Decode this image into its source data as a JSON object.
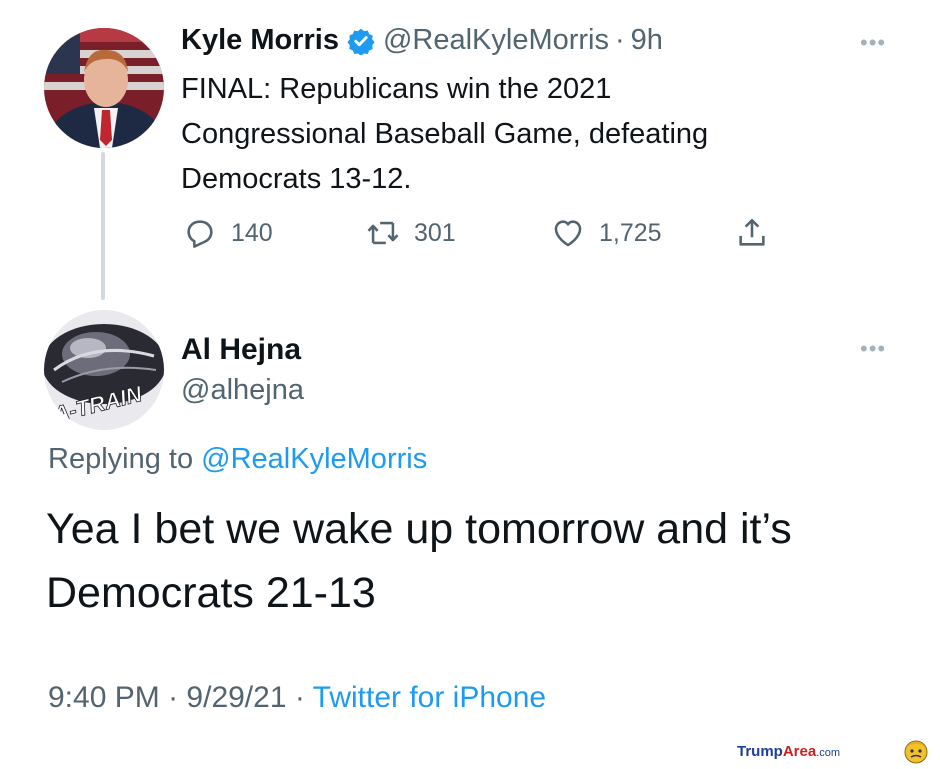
{
  "tweet": {
    "author_name": "Kyle Morris",
    "author_handle": "@RealKyleMorris",
    "separator": "·",
    "time_ago": "9h",
    "text_lines": [
      "FINAL: Republicans win the 2021",
      "Congressional Baseball Game, defeating",
      "Democrats 13-12."
    ],
    "more_label": "•••",
    "actions": {
      "reply_count": "140",
      "retweet_count": "301",
      "like_count": "1,725"
    }
  },
  "reply": {
    "author_name": "Al Hejna",
    "author_handle": "@alhejna",
    "avatar_text": "A-TRAIN",
    "more_label": "•••",
    "replying_prefix": "Replying to",
    "replying_mention": "@RealKyleMorris",
    "text_lines": [
      "Yea I bet we wake up tomorrow and it’s",
      "Democrats 21-13"
    ],
    "time": "9:40 PM",
    "separator": "·",
    "date": "9/29/21",
    "source": "Twitter for iPhone"
  },
  "watermark": {
    "part1": "Trump",
    "part2": "Area",
    "part3": ".com"
  },
  "colors": {
    "accent": "#1d9bf0",
    "secondary_text": "#536471",
    "verified": "#1d9bf0"
  }
}
